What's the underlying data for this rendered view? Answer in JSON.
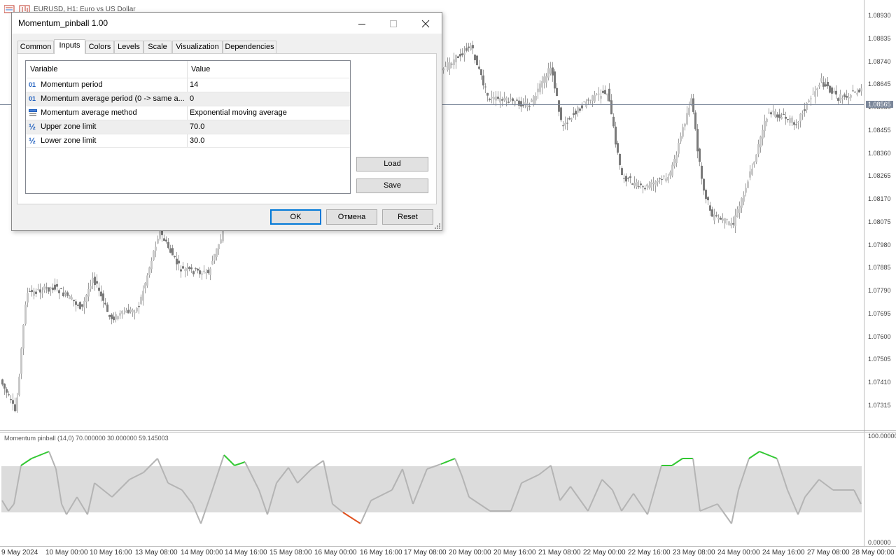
{
  "window": {
    "title": "EURUSD, H1:  Euro vs US Dollar"
  },
  "chart": {
    "price_labels": [
      "1.08930",
      "1.08835",
      "1.08740",
      "1.08645",
      "1.08550",
      "1.08455",
      "1.08360",
      "1.08265",
      "1.08170",
      "1.08075",
      "1.07980",
      "1.07885",
      "1.07790",
      "1.07695",
      "1.07600",
      "1.07505",
      "1.07410",
      "1.07315"
    ],
    "current_price": "1.08565",
    "time_labels": [
      "9 May 2024",
      "10 May 00:00",
      "10 May 16:00",
      "13 May 08:00",
      "14 May 00:00",
      "14 May 16:00",
      "15 May 08:00",
      "16 May 00:00",
      "16 May 16:00",
      "17 May 08:00",
      "20 May 00:00",
      "20 May 16:00",
      "21 May 08:00",
      "22 May 00:00",
      "22 May 16:00",
      "23 May 08:00",
      "24 May 00:00",
      "24 May 16:00",
      "27 May 08:00",
      "28 May 00:00"
    ],
    "colors": {
      "candle": "#9e9e9e",
      "bull": "#c8c8c8",
      "bear": "#7a7a7a",
      "current_line": "#7a8699"
    }
  },
  "indicator": {
    "title": "Momentum pinball (14,0) 70.000000 30.000000 59.145003",
    "scale_top": "100.00000",
    "scale_bottom": "0.00000",
    "colors": {
      "zone": "#dcdcdc",
      "line": "#b4b4b4",
      "up": "#32c832",
      "down": "#e0501e"
    }
  },
  "dialog": {
    "title": "Momentum_pinball 1.00",
    "tabs": [
      "Common",
      "Inputs",
      "Colors",
      "Levels",
      "Scale",
      "Visualization",
      "Dependencies"
    ],
    "active_tab": "Inputs",
    "table": {
      "headers": {
        "variable": "Variable",
        "value": "Value"
      },
      "rows": [
        {
          "icon": "integer-icon",
          "icon_text": "01",
          "name": "Momentum period",
          "value": "14"
        },
        {
          "icon": "integer-icon",
          "icon_text": "01",
          "name": "Momentum average period (0 -> same a...",
          "value": "0"
        },
        {
          "icon": "enum-list-icon",
          "icon_text": "",
          "name": "Momentum average method",
          "value": "Exponential moving average"
        },
        {
          "icon": "fraction-icon",
          "icon_text": "½",
          "name": "Upper zone limit",
          "value": "70.0"
        },
        {
          "icon": "fraction-icon",
          "icon_text": "½",
          "name": "Lower zone limit",
          "value": "30.0"
        }
      ]
    },
    "buttons": {
      "load": "Load",
      "save": "Save",
      "ok": "OK",
      "cancel": "Отмена",
      "reset": "Reset"
    }
  }
}
